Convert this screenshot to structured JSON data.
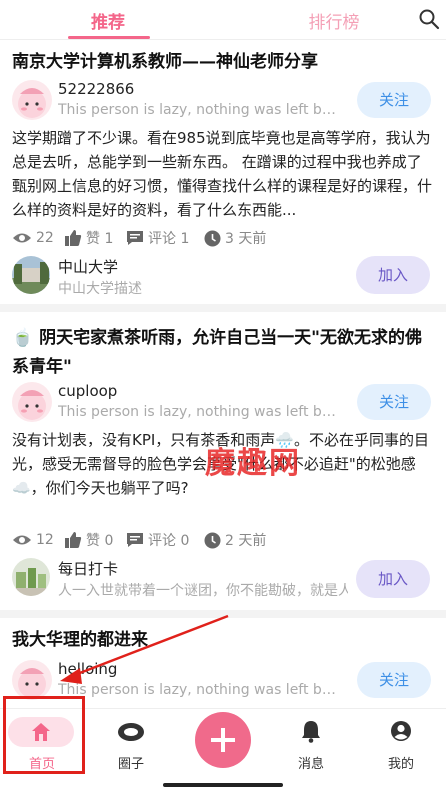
{
  "top_tabs": {
    "recommend": "推荐",
    "ranking": "排行榜"
  },
  "posts": [
    {
      "title": "南京大学计算机系教师——神仙老师分享",
      "user": "52222866",
      "bio": "This person is lazy, nothing was left behind",
      "follow_label": "关注",
      "content": "这学期蹭了不少课。看在985说到底毕竟也是高等学府，我认为总是去听，总能学到一些新东西。 在蹭课的过程中我也养成了甄别网上信息的好习惯，懂得查找什么样的课程是好的课程，什么样的资料是好的资料，看了什么东西能...",
      "views": "22",
      "likes": "赞 1",
      "comments": "评论 1",
      "time": "3 天前",
      "group_name": "中山大学",
      "group_desc": "中山大学描述",
      "join_label": "加入"
    },
    {
      "title": "🍵 阴天宅家煮茶听雨，允许自己当一天\"无欲无求的佛系青年\"",
      "user": "cuploop",
      "bio": "This person is lazy, nothing was left behind",
      "follow_label": "关注",
      "content": "没有计划表，没有KPI，只有茶香和雨声🌧️。不必在乎同事的目光，感受无需督导的脸色学会享受\"什么都不必追赶\"的松弛感☁️，你们今天也躺平了吗?",
      "views": "12",
      "likes": "赞 0",
      "comments": "评论 0",
      "time": "2 天前",
      "group_name": "每日打卡",
      "group_desc": "人一入世就带着一个谜团，你不能勘破，就是人生",
      "join_label": "加入"
    },
    {
      "title": "我大华理的都进来",
      "user": "helloing",
      "bio": "This person is lazy, nothing was left behind",
      "follow_label": "关注"
    }
  ],
  "watermark": "魔趣网",
  "bottom_nav": {
    "home": "首页",
    "circle": "圈子",
    "messages": "消息",
    "mine": "我的"
  },
  "colors": {
    "accent": "#f4668a",
    "follow_bg": "#e3f0fd",
    "join_bg": "#e6e3f9",
    "annotation": "#e0211b"
  },
  "icons": [
    "search-icon",
    "eye-icon",
    "thumbs-up-icon",
    "comment-icon",
    "clock-icon",
    "home-icon",
    "circle-icon",
    "plus-icon",
    "bell-icon",
    "user-icon"
  ]
}
